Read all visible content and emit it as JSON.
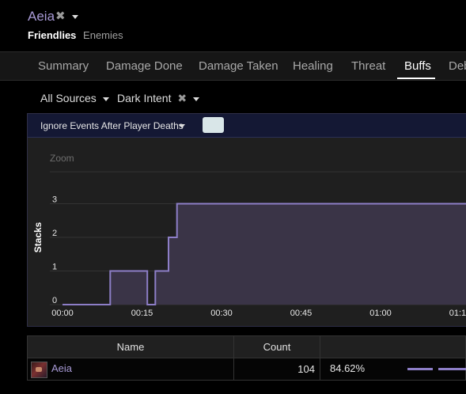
{
  "character": {
    "name": "Aeia",
    "remove_icon": "x-icon",
    "menu_icon": "caret-down-icon"
  },
  "view_tabs": [
    "Friendlies",
    "Enemies"
  ],
  "tabs": [
    "Summary",
    "Damage Done",
    "Damage Taken",
    "Healing",
    "Threat",
    "Buffs",
    "Deb"
  ],
  "active_tab": "Buffs",
  "filters": {
    "source": "All Sources",
    "ability": "Dark Intent"
  },
  "options": {
    "ignore_events": "Ignore Events After Player Deaths"
  },
  "colors": {
    "accent": "#a89ad6",
    "series": "#8d7ec7",
    "series_fill": "#3a3447",
    "header_bar": "#141834"
  },
  "chart_data": {
    "type": "area",
    "zoom_label": "Zoom",
    "ylabel": "Stacks",
    "ylim": [
      0,
      3
    ],
    "yticks": [
      "0",
      "1",
      "2",
      "3"
    ],
    "xticks": [
      "00:00",
      "00:15",
      "00:30",
      "00:45",
      "01:00",
      "01:15"
    ],
    "xlim_seconds": [
      0,
      82
    ],
    "series": [
      {
        "points": [
          [
            0,
            0
          ],
          [
            9,
            0
          ],
          [
            9,
            1
          ],
          [
            16,
            1
          ],
          [
            16,
            0
          ],
          [
            17.5,
            0
          ],
          [
            17.5,
            1
          ],
          [
            20,
            1
          ],
          [
            20,
            2
          ],
          [
            21.6,
            2
          ],
          [
            21.6,
            3
          ],
          [
            82,
            3
          ]
        ]
      }
    ]
  },
  "table": {
    "columns": [
      "Name",
      "Count",
      ""
    ],
    "rows": [
      {
        "name": "Aeia",
        "count": "104",
        "percent": "84.62%"
      }
    ]
  }
}
